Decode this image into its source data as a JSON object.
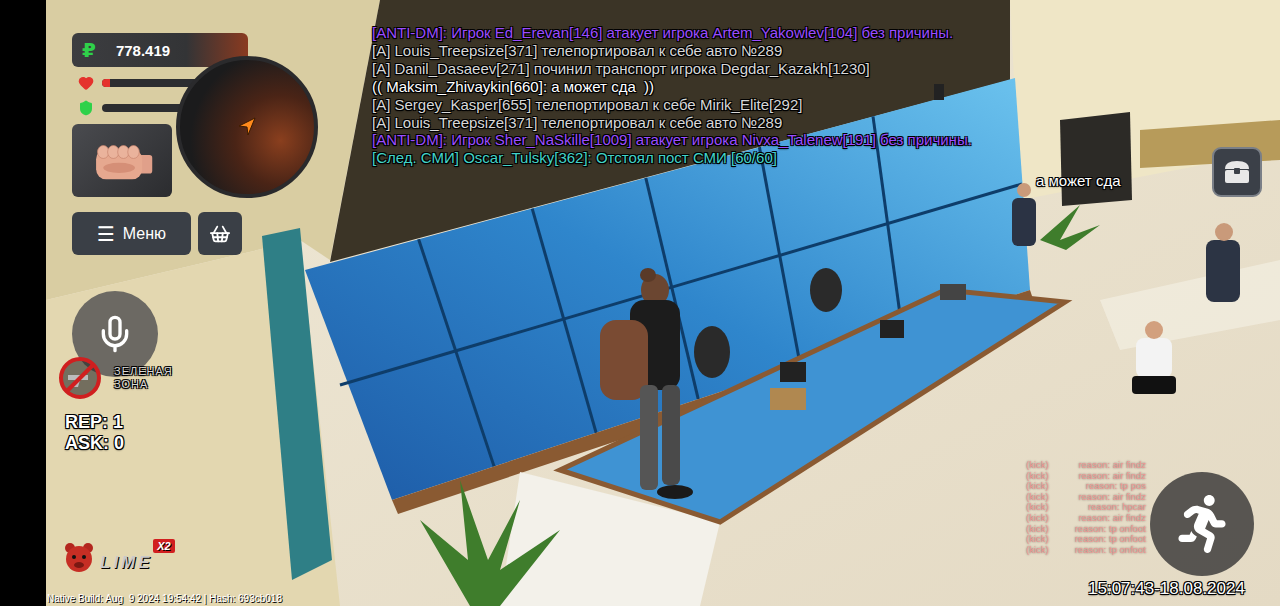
{
  "hud": {
    "money": {
      "currency": "₽",
      "amount": "778.419"
    },
    "health": {
      "level": 0.08
    },
    "armor": {
      "level": 0
    },
    "menu_button": {
      "icon": "☰",
      "label": "Меню"
    },
    "zone": {
      "label": "ЗЕЛЕНАЯ ЗОНА"
    },
    "stats": [
      "REP: 1",
      "ASK: 0"
    ],
    "logo": {
      "name": "LIME",
      "badge": "X2"
    },
    "build_info": "Native Build: Aug  9 2024 19:54:42 | Hash: 693cb018",
    "clock": "15:07:43-18.08.2024"
  },
  "chat": [
    {
      "text": "[ANTI-DM]: Игрок Ed_Erevan[146] атакует игрока Artem_Yakowlev[104] без причины.",
      "color": "#9b4dff"
    },
    {
      "text": "[A] Louis_Treepsize[371] телепортировал к себе авто №289",
      "color": "#d8d8d8"
    },
    {
      "text": "[A] Danil_Dasaeev[271] починил транспорт игрока Degdar_Kazakh[1230]",
      "color": "#d8d8d8"
    },
    {
      "text": "(( Maksim_Zhivaykin[660]: а может сда  ))",
      "color": "#ffffff"
    },
    {
      "text": "[A] Sergey_Kasper[655] телепортировал к себе Mirik_Elite[292]",
      "color": "#d8d8d8"
    },
    {
      "text": "[A] Louis_Treepsize[371] телепортировал к себе авто №289",
      "color": "#d8d8d8"
    },
    {
      "text": "[ANTI-DM]: Игрок Sher_NaSkille[1009] атакует игрока Nivxa_Talenew[191] без причины.",
      "color": "#9b4dff"
    },
    {
      "text": "[След. СМИ] Oscar_Tulsky[362]: Отстоял пост СМИ [60/60]",
      "color": "#43d3c8"
    }
  ],
  "speech_bubble": {
    "text": "а может сда"
  },
  "kick_log": [
    {
      "tag": "(kick)",
      "reason": "reason: air findz"
    },
    {
      "tag": "(kick)",
      "reason": "reason: air findz"
    },
    {
      "tag": "(kick)",
      "reason": "reason: tp pos"
    },
    {
      "tag": "(kick)",
      "reason": "reason: air findz"
    },
    {
      "tag": "(kick)",
      "reason": "reason: hpcar"
    },
    {
      "tag": "(kick)",
      "reason": "reason: air findz"
    },
    {
      "tag": "(kick)",
      "reason": "reason: tp onfoot"
    },
    {
      "tag": "(kick)",
      "reason": "reason: tp onfoot"
    },
    {
      "tag": "(kick)",
      "reason": "reason: tp onfoot"
    }
  ]
}
